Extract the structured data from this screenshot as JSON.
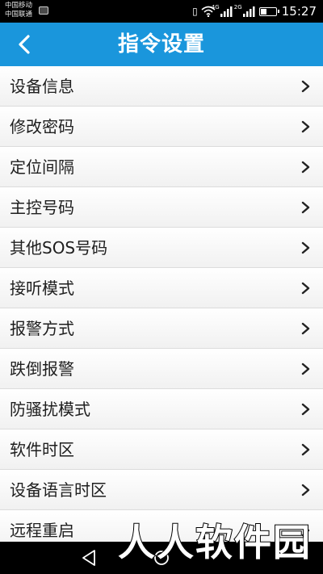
{
  "status_bar": {
    "carrier_1": "中国移动",
    "carrier_2": "中国联通",
    "network_tag_1": "4G",
    "network_tag_2": "2G",
    "battery_level": 0.45,
    "time": "15:27"
  },
  "header": {
    "title": "指令设置",
    "color": "#1a96dc"
  },
  "menu": {
    "items": [
      {
        "label": "设备信息"
      },
      {
        "label": "修改密码"
      },
      {
        "label": "定位间隔"
      },
      {
        "label": "主控号码"
      },
      {
        "label": "其他SOS号码"
      },
      {
        "label": "接听模式"
      },
      {
        "label": "报警方式"
      },
      {
        "label": "跌倒报警"
      },
      {
        "label": "防骚扰模式"
      },
      {
        "label": "软件时区"
      },
      {
        "label": "设备语言时区"
      },
      {
        "label": "远程重启"
      }
    ]
  },
  "watermark": {
    "text": "人人软件园"
  }
}
